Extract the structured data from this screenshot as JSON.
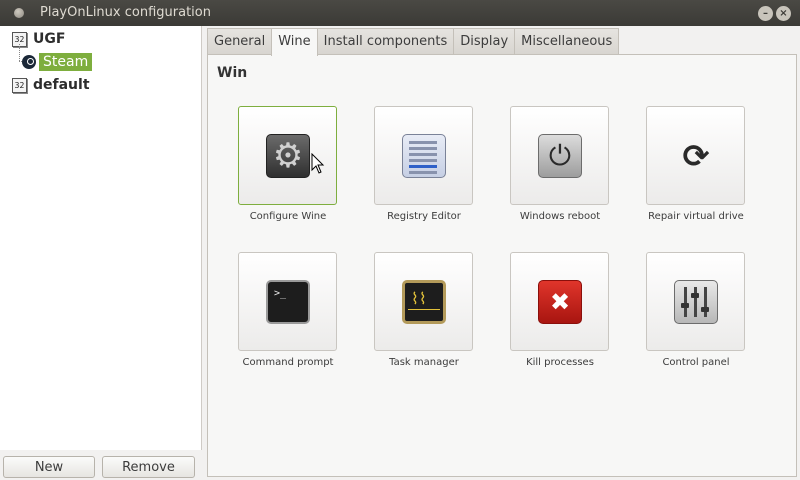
{
  "window": {
    "title": "PlayOnLinux configuration",
    "minimize_glyph": "–",
    "close_glyph": "×"
  },
  "tree": {
    "items": [
      {
        "label": "UGF",
        "badge": "32"
      },
      {
        "label": "Steam",
        "selected": true
      },
      {
        "label": "default",
        "badge": "32"
      }
    ]
  },
  "buttons": {
    "new_label": "New",
    "remove_label": "Remove"
  },
  "tabs": [
    "General",
    "Wine",
    "Install components",
    "Display",
    "Miscellaneous"
  ],
  "active_tab": "Wine",
  "section_title": "Win",
  "tiles": [
    {
      "label": "Configure Wine",
      "icon": "gear-icon"
    },
    {
      "label": "Registry Editor",
      "icon": "registry-editor-icon"
    },
    {
      "label": "Windows reboot",
      "icon": "power-icon"
    },
    {
      "label": "Repair virtual drive",
      "icon": "refresh-icon"
    },
    {
      "label": "Command prompt",
      "icon": "terminal-icon"
    },
    {
      "label": "Task manager",
      "icon": "task-manager-icon"
    },
    {
      "label": "Kill processes",
      "icon": "close-icon"
    },
    {
      "label": "Control panel",
      "icon": "sliders-icon"
    }
  ],
  "colors": {
    "selection_accent": "#7eae3e",
    "titlebar": "#3b3a36",
    "kill_red": "#c8201a"
  }
}
